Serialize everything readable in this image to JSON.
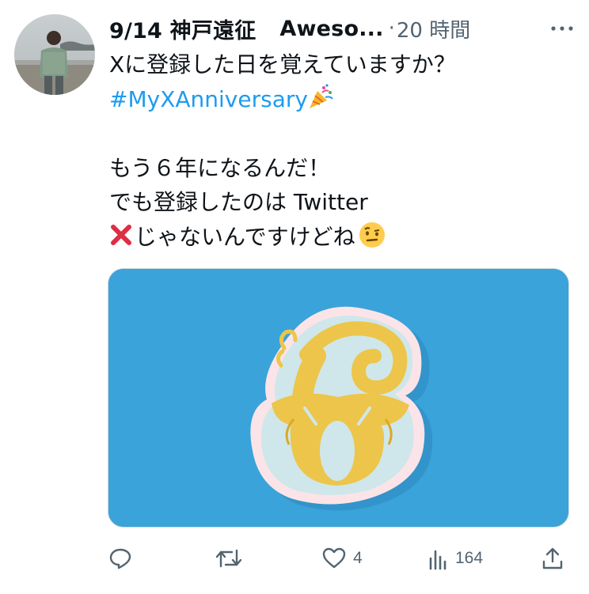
{
  "tweet": {
    "author_name": "9/14 神戸遠征",
    "author_name_extra": "Aweso...",
    "timestamp": "20 時間",
    "text_line1": "Xに登録した日を覚えていますか？",
    "hashtag": "#MyXAnniversary",
    "text_line3": "もう６年になるんだ！",
    "text_line4": "でも登録したのは Twitter",
    "text_line5": "じゃないんですけどね"
  },
  "media": {
    "subject": "6",
    "colors": {
      "background": "#3aa3da",
      "letter": "#ecc94b",
      "outline": "#fde7ec"
    }
  },
  "actions": {
    "reply_count": "",
    "retweet_count": "",
    "like_count": "4",
    "views_count": "164"
  },
  "icons": {
    "more": "more-icon",
    "reply": "reply-icon",
    "retweet": "retweet-icon",
    "like": "like-icon",
    "views": "views-icon",
    "share": "share-icon",
    "party": "party-popper-icon",
    "cross": "cross-mark-icon",
    "emoji": "raised-eyebrow-face-icon"
  },
  "colors": {
    "link": "#1d9bf0",
    "secondary_text": "#536471",
    "primary_text": "#0f1419"
  }
}
